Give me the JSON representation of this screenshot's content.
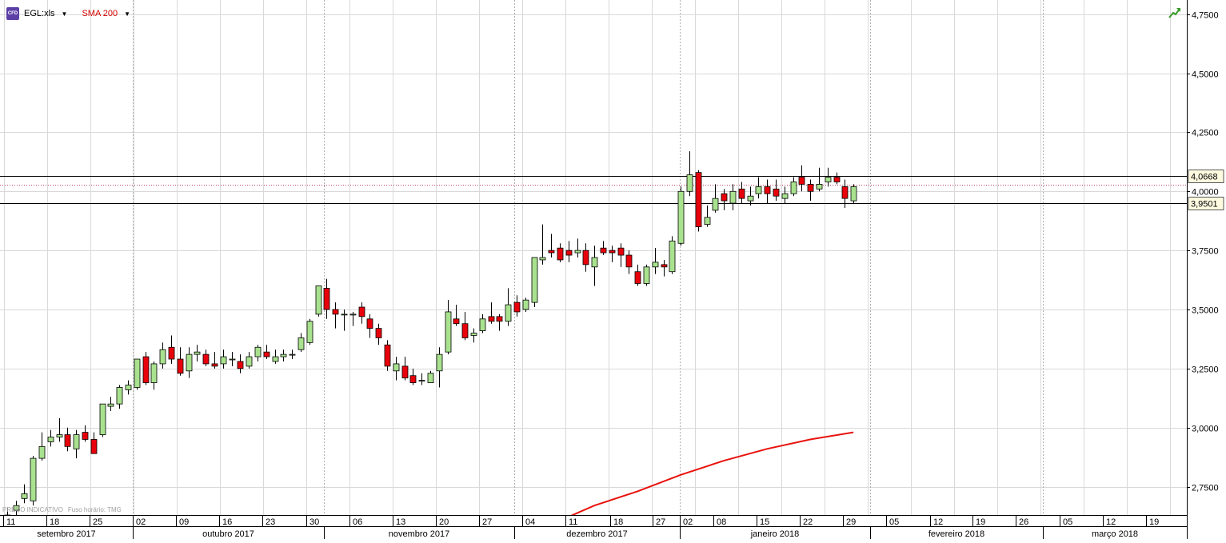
{
  "header": {
    "badge": "CFD",
    "symbol": "EGL:xls",
    "indicator": "SMA 200"
  },
  "footer_note": {
    "price_label": "PREÇO INDICATIVO",
    "timezone_label": "Fuso horário: TMG"
  },
  "colors": {
    "up": "#a9e28f",
    "down": "#e8000b",
    "sma": "#e8120c",
    "grid": "#d9d9d9"
  },
  "chart_data": {
    "type": "candlestick",
    "title": "",
    "y_axis": {
      "ticks": [
        2.75,
        3.0,
        3.25,
        3.5,
        3.75,
        4.0,
        4.25,
        4.5,
        4.75
      ],
      "tick_labels": [
        "2,7500",
        "3,0000",
        "3,2500",
        "3,5000",
        "3,7500",
        "4,0000",
        "4,2500",
        "4,5000",
        "4,7500"
      ],
      "range": [
        2.63,
        4.81
      ]
    },
    "x_axis": {
      "day_labels": [
        "11",
        "18",
        "25",
        "02",
        "09",
        "16",
        "23",
        "30",
        "06",
        "13",
        "20",
        "27",
        "04",
        "11",
        "18",
        "27",
        "02",
        "08",
        "15",
        "22",
        "29",
        "05",
        "12",
        "19",
        "26",
        "05",
        "12",
        "19"
      ],
      "months": [
        "setembro 2017",
        "outubro 2017",
        "novembro 2017",
        "dezembro 2017",
        "janeiro 2018",
        "fevereiro 2018",
        "março 2018"
      ]
    },
    "horizontal_lines": [
      {
        "value": 4.0668,
        "label": "4,0668"
      },
      {
        "value": 3.9501,
        "label": "3,9501"
      }
    ],
    "reference_line": 4.0288,
    "candles": [
      {
        "o": 2.6,
        "h": 2.66,
        "l": 2.58,
        "c": 2.63
      },
      {
        "o": 2.65,
        "h": 2.69,
        "l": 2.62,
        "c": 2.67
      },
      {
        "o": 2.7,
        "h": 2.76,
        "l": 2.68,
        "c": 2.72
      },
      {
        "o": 2.69,
        "h": 2.88,
        "l": 2.67,
        "c": 2.87
      },
      {
        "o": 2.87,
        "h": 2.98,
        "l": 2.86,
        "c": 2.92
      },
      {
        "o": 2.94,
        "h": 2.99,
        "l": 2.92,
        "c": 2.96
      },
      {
        "o": 2.96,
        "h": 3.04,
        "l": 2.94,
        "c": 2.97
      },
      {
        "o": 2.97,
        "h": 3.0,
        "l": 2.9,
        "c": 2.92
      },
      {
        "o": 2.91,
        "h": 2.99,
        "l": 2.87,
        "c": 2.97
      },
      {
        "o": 2.98,
        "h": 3.01,
        "l": 2.94,
        "c": 2.95
      },
      {
        "o": 2.95,
        "h": 2.98,
        "l": 2.89,
        "c": 2.89
      },
      {
        "o": 2.97,
        "h": 3.1,
        "l": 2.96,
        "c": 3.1
      },
      {
        "o": 3.09,
        "h": 3.13,
        "l": 3.07,
        "c": 3.1
      },
      {
        "o": 3.1,
        "h": 3.18,
        "l": 3.08,
        "c": 3.17
      },
      {
        "o": 3.16,
        "h": 3.2,
        "l": 3.14,
        "c": 3.18
      },
      {
        "o": 3.17,
        "h": 3.29,
        "l": 3.16,
        "c": 3.29
      },
      {
        "o": 3.3,
        "h": 3.32,
        "l": 3.18,
        "c": 3.19
      },
      {
        "o": 3.19,
        "h": 3.28,
        "l": 3.16,
        "c": 3.27
      },
      {
        "o": 3.27,
        "h": 3.36,
        "l": 3.25,
        "c": 3.33
      },
      {
        "o": 3.34,
        "h": 3.39,
        "l": 3.27,
        "c": 3.29
      },
      {
        "o": 3.29,
        "h": 3.34,
        "l": 3.22,
        "c": 3.23
      },
      {
        "o": 3.24,
        "h": 3.34,
        "l": 3.21,
        "c": 3.31
      },
      {
        "o": 3.31,
        "h": 3.35,
        "l": 3.28,
        "c": 3.32
      },
      {
        "o": 3.31,
        "h": 3.33,
        "l": 3.26,
        "c": 3.27
      },
      {
        "o": 3.27,
        "h": 3.32,
        "l": 3.25,
        "c": 3.26
      },
      {
        "o": 3.27,
        "h": 3.33,
        "l": 3.25,
        "c": 3.3
      },
      {
        "o": 3.29,
        "h": 3.32,
        "l": 3.26,
        "c": 3.29
      },
      {
        "o": 3.28,
        "h": 3.31,
        "l": 3.23,
        "c": 3.25
      },
      {
        "o": 3.26,
        "h": 3.32,
        "l": 3.25,
        "c": 3.3
      },
      {
        "o": 3.3,
        "h": 3.35,
        "l": 3.28,
        "c": 3.34
      },
      {
        "o": 3.32,
        "h": 3.35,
        "l": 3.29,
        "c": 3.3
      },
      {
        "o": 3.28,
        "h": 3.33,
        "l": 3.27,
        "c": 3.3
      },
      {
        "o": 3.3,
        "h": 3.33,
        "l": 3.28,
        "c": 3.31
      },
      {
        "o": 3.31,
        "h": 3.33,
        "l": 3.29,
        "c": 3.31
      },
      {
        "o": 3.33,
        "h": 3.4,
        "l": 3.32,
        "c": 3.38
      },
      {
        "o": 3.36,
        "h": 3.46,
        "l": 3.35,
        "c": 3.45
      },
      {
        "o": 3.48,
        "h": 3.6,
        "l": 3.47,
        "c": 3.6
      },
      {
        "o": 3.59,
        "h": 3.63,
        "l": 3.46,
        "c": 3.5
      },
      {
        "o": 3.5,
        "h": 3.53,
        "l": 3.42,
        "c": 3.48
      },
      {
        "o": 3.48,
        "h": 3.5,
        "l": 3.41,
        "c": 3.48
      },
      {
        "o": 3.48,
        "h": 3.49,
        "l": 3.43,
        "c": 3.48
      },
      {
        "o": 3.51,
        "h": 3.53,
        "l": 3.44,
        "c": 3.47
      },
      {
        "o": 3.46,
        "h": 3.48,
        "l": 3.38,
        "c": 3.42
      },
      {
        "o": 3.42,
        "h": 3.44,
        "l": 3.35,
        "c": 3.38
      },
      {
        "o": 3.35,
        "h": 3.37,
        "l": 3.24,
        "c": 3.26
      },
      {
        "o": 3.24,
        "h": 3.3,
        "l": 3.2,
        "c": 3.27
      },
      {
        "o": 3.26,
        "h": 3.3,
        "l": 3.2,
        "c": 3.21
      },
      {
        "o": 3.22,
        "h": 3.25,
        "l": 3.18,
        "c": 3.19
      },
      {
        "o": 3.2,
        "h": 3.23,
        "l": 3.18,
        "c": 3.2
      },
      {
        "o": 3.19,
        "h": 3.24,
        "l": 3.19,
        "c": 3.23
      },
      {
        "o": 3.24,
        "h": 3.34,
        "l": 3.17,
        "c": 3.31
      },
      {
        "o": 3.32,
        "h": 3.54,
        "l": 3.31,
        "c": 3.49
      },
      {
        "o": 3.46,
        "h": 3.52,
        "l": 3.43,
        "c": 3.44
      },
      {
        "o": 3.44,
        "h": 3.49,
        "l": 3.37,
        "c": 3.38
      },
      {
        "o": 3.39,
        "h": 3.42,
        "l": 3.36,
        "c": 3.4
      },
      {
        "o": 3.41,
        "h": 3.48,
        "l": 3.4,
        "c": 3.46
      },
      {
        "o": 3.47,
        "h": 3.53,
        "l": 3.44,
        "c": 3.45
      },
      {
        "o": 3.47,
        "h": 3.48,
        "l": 3.41,
        "c": 3.45
      },
      {
        "o": 3.45,
        "h": 3.59,
        "l": 3.43,
        "c": 3.52
      },
      {
        "o": 3.53,
        "h": 3.56,
        "l": 3.47,
        "c": 3.49
      },
      {
        "o": 3.5,
        "h": 3.55,
        "l": 3.49,
        "c": 3.54
      },
      {
        "o": 3.53,
        "h": 3.72,
        "l": 3.51,
        "c": 3.72
      },
      {
        "o": 3.71,
        "h": 3.86,
        "l": 3.69,
        "c": 3.72
      },
      {
        "o": 3.75,
        "h": 3.82,
        "l": 3.72,
        "c": 3.74
      },
      {
        "o": 3.76,
        "h": 3.78,
        "l": 3.7,
        "c": 3.71
      },
      {
        "o": 3.75,
        "h": 3.79,
        "l": 3.7,
        "c": 3.73
      },
      {
        "o": 3.74,
        "h": 3.8,
        "l": 3.72,
        "c": 3.75
      },
      {
        "o": 3.75,
        "h": 3.78,
        "l": 3.66,
        "c": 3.69
      },
      {
        "o": 3.68,
        "h": 3.77,
        "l": 3.6,
        "c": 3.72
      },
      {
        "o": 3.76,
        "h": 3.79,
        "l": 3.73,
        "c": 3.74
      },
      {
        "o": 3.75,
        "h": 3.77,
        "l": 3.7,
        "c": 3.74
      },
      {
        "o": 3.76,
        "h": 3.78,
        "l": 3.68,
        "c": 3.73
      },
      {
        "o": 3.73,
        "h": 3.75,
        "l": 3.65,
        "c": 3.68
      },
      {
        "o": 3.66,
        "h": 3.69,
        "l": 3.6,
        "c": 3.61
      },
      {
        "o": 3.61,
        "h": 3.69,
        "l": 3.6,
        "c": 3.68
      },
      {
        "o": 3.68,
        "h": 3.76,
        "l": 3.65,
        "c": 3.7
      },
      {
        "o": 3.69,
        "h": 3.71,
        "l": 3.64,
        "c": 3.68
      },
      {
        "o": 3.66,
        "h": 3.81,
        "l": 3.65,
        "c": 3.79
      },
      {
        "o": 3.78,
        "h": 4.02,
        "l": 3.77,
        "c": 4.0
      },
      {
        "o": 4.0,
        "h": 4.17,
        "l": 3.98,
        "c": 4.07
      },
      {
        "o": 4.08,
        "h": 4.09,
        "l": 3.83,
        "c": 3.85
      },
      {
        "o": 3.86,
        "h": 3.94,
        "l": 3.85,
        "c": 3.89
      },
      {
        "o": 3.92,
        "h": 4.03,
        "l": 3.91,
        "c": 3.97
      },
      {
        "o": 3.99,
        "h": 4.01,
        "l": 3.92,
        "c": 3.96
      },
      {
        "o": 3.95,
        "h": 4.03,
        "l": 3.92,
        "c": 4.0
      },
      {
        "o": 4.01,
        "h": 4.04,
        "l": 3.95,
        "c": 3.97
      },
      {
        "o": 3.96,
        "h": 4.02,
        "l": 3.94,
        "c": 3.98
      },
      {
        "o": 3.99,
        "h": 4.06,
        "l": 3.97,
        "c": 4.02
      },
      {
        "o": 4.02,
        "h": 4.05,
        "l": 3.95,
        "c": 3.99
      },
      {
        "o": 4.01,
        "h": 4.05,
        "l": 3.96,
        "c": 3.98
      },
      {
        "o": 3.97,
        "h": 4.02,
        "l": 3.95,
        "c": 3.99
      },
      {
        "o": 3.99,
        "h": 4.06,
        "l": 3.98,
        "c": 4.04
      },
      {
        "o": 4.06,
        "h": 4.11,
        "l": 4.0,
        "c": 4.03
      },
      {
        "o": 4.03,
        "h": 4.05,
        "l": 3.96,
        "c": 4.0
      },
      {
        "o": 4.01,
        "h": 4.1,
        "l": 4.0,
        "c": 4.03
      },
      {
        "o": 4.04,
        "h": 4.1,
        "l": 4.02,
        "c": 4.06
      },
      {
        "o": 4.06,
        "h": 4.08,
        "l": 4.03,
        "c": 4.04
      },
      {
        "o": 4.02,
        "h": 4.05,
        "l": 3.93,
        "c": 3.97
      },
      {
        "o": 3.96,
        "h": 4.03,
        "l": 3.95,
        "c": 4.02
      }
    ],
    "sma_200": [
      {
        "i": 63,
        "v": 2.59
      },
      {
        "i": 68,
        "v": 2.67
      },
      {
        "i": 73,
        "v": 2.73
      },
      {
        "i": 78,
        "v": 2.8
      },
      {
        "i": 83,
        "v": 2.86
      },
      {
        "i": 88,
        "v": 2.91
      },
      {
        "i": 93,
        "v": 2.95
      },
      {
        "i": 98,
        "v": 2.98
      }
    ]
  }
}
